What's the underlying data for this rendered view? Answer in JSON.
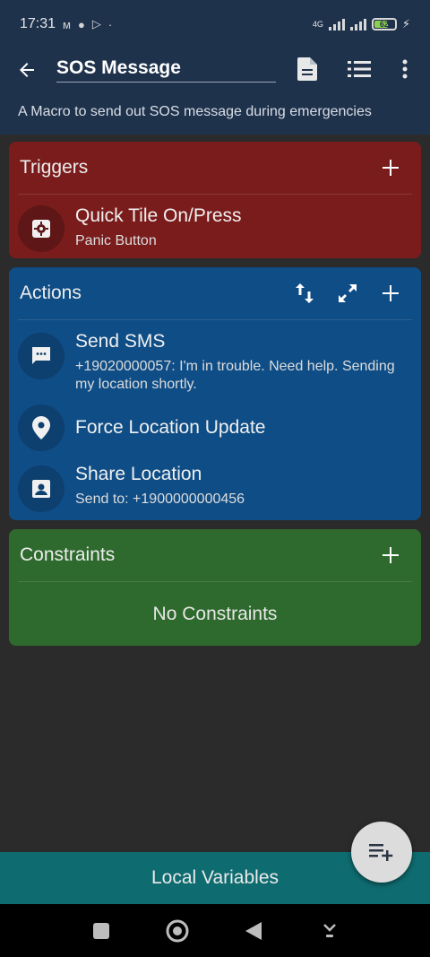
{
  "status_bar": {
    "time": "17:31",
    "notification_icons": [
      "m-icon",
      "reddit-icon",
      "play-icon",
      "dot"
    ],
    "network": "4G",
    "battery_level": "62",
    "charging": true
  },
  "app_bar": {
    "macro_name": "SOS Message",
    "description": "A Macro to send out SOS message during emergencies"
  },
  "triggers": {
    "title": "Triggers",
    "items": [
      {
        "title": "Quick Tile On/Press",
        "subtitle": "Panic Button",
        "icon": "gear-tile-icon"
      }
    ]
  },
  "actions": {
    "title": "Actions",
    "items": [
      {
        "title": "Send SMS",
        "subtitle": "+19020000057: I'm in trouble. Need help. Sending my location shortly.",
        "icon": "sms-icon"
      },
      {
        "title": "Force Location Update",
        "subtitle": "",
        "icon": "location-pin-icon"
      },
      {
        "title": "Share Location",
        "subtitle": "Send to: +1900000000456",
        "icon": "contact-card-icon"
      }
    ]
  },
  "constraints": {
    "title": "Constraints",
    "empty_text": "No Constraints"
  },
  "bottom": {
    "local_variables_label": "Local Variables"
  },
  "colors": {
    "app_bar": "#1f324c",
    "triggers": "#7b1c1c",
    "actions": "#0f4d86",
    "constraints": "#2e6a2d",
    "local_variables": "#0e6c70",
    "fab": "#dcdcdc"
  }
}
